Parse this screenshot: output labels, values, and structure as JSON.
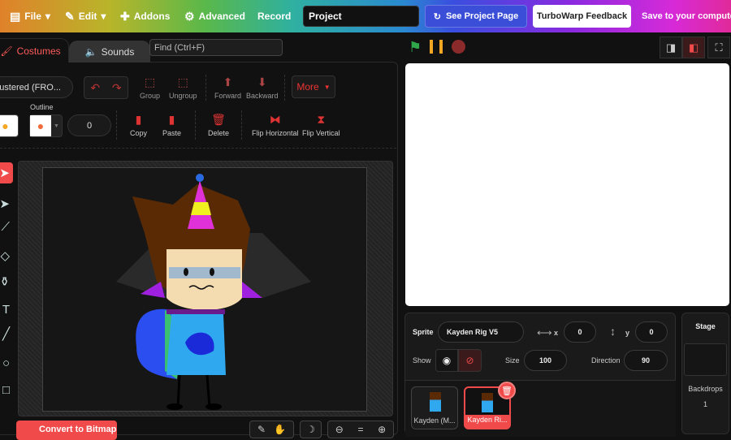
{
  "menubar": {
    "file": "File",
    "edit": "Edit",
    "addons": "Addons",
    "advanced": "Advanced",
    "record": "Record",
    "project_title": "Project",
    "see_project_page": "See Project Page",
    "feedback": "TurboWarp Feedback",
    "save": "Save to your computer"
  },
  "tabs": {
    "costumes": "Costumes",
    "sounds": "Sounds",
    "find_placeholder": "Find (Ctrl+F)"
  },
  "paint": {
    "costume_name": "lustered (FRO...",
    "group": "Group",
    "ungroup": "Ungroup",
    "forward": "Forward",
    "backward": "Backward",
    "more": "More",
    "outline_label": "Outline",
    "outline_width": "0",
    "copy": "Copy",
    "paste": "Paste",
    "delete": "Delete",
    "flip_h": "Flip Horizontal",
    "flip_v": "Flip Vertical",
    "convert": "Convert to Bitmap"
  },
  "sprite": {
    "label": "Sprite",
    "name": "Kayden Rig V5",
    "x_label": "x",
    "x": "0",
    "y_label": "y",
    "y": "0",
    "show_label": "Show",
    "size_label": "Size",
    "size": "100",
    "direction_label": "Direction",
    "direction": "90"
  },
  "sprites": [
    {
      "name": "Kayden (M..."
    },
    {
      "name": "Kayden Ri..."
    }
  ],
  "stage_panel": {
    "title": "Stage",
    "backdrops_label": "Backdrops",
    "backdrops_count": "1"
  },
  "colors": {
    "accent": "#ff4c4c",
    "flag": "#2fa84a",
    "pause": "#f5a623"
  }
}
